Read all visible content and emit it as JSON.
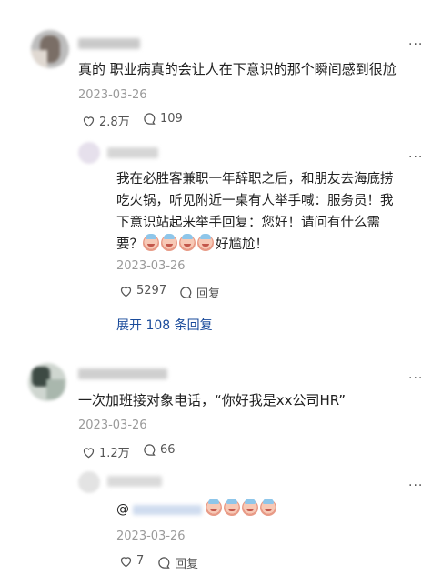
{
  "comments": [
    {
      "text": "真的 职业病真的会让人在下意识的那个瞬间感到很尬",
      "date": "2023-03-26",
      "likes": "2.8万",
      "replies": "109",
      "reply": {
        "text_line1": "我在必胜客兼职一年辞职之后，和朋友去海底捞",
        "text_line2": "吃火锅，听见附近一桌有人举手喊：服务员！我",
        "text_line3": "下意识站起来举手回复：您好！请问有什么需",
        "text_line4_prefix": "要？",
        "text_line4_suffix": "好尴尬！",
        "date": "2023-03-26",
        "likes": "5297",
        "reply_label": "回复"
      },
      "expand_label": "展开 108 条回复"
    },
    {
      "text": "一次加班接对象电话，“你好我是xx公司HR”",
      "date": "2023-03-26",
      "likes": "1.2万",
      "replies": "66",
      "reply": {
        "text_prefix": "@",
        "date": "2023-03-26",
        "likes": "7",
        "reply_label": "回复"
      }
    }
  ],
  "icons": {
    "more": "more-dots-icon",
    "like": "heart-icon",
    "comment": "comment-bubble-icon",
    "emoji": "crying-face-emoji-icon"
  },
  "colors": {
    "link": "#1a4b9b",
    "date": "#9a9a9a"
  }
}
